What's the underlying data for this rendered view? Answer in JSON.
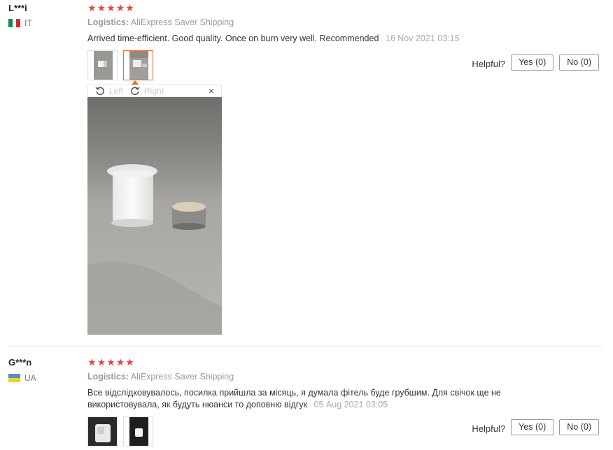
{
  "reviews": [
    {
      "user": "L***i",
      "country": "IT",
      "rating_stars": 5,
      "logistics_label": "Logistics:",
      "logistics_value": "AliExpress Saver Shipping",
      "text": "Arrived time-efficient. Good quality. Once on burn very well. Recommended",
      "date": "16 Nov 2021 03:15",
      "helpful_label": "Helpful?",
      "yes_label": "Yes (0)",
      "no_label": "No (0)",
      "viewer": {
        "left_label": "Left",
        "right_label": "Right",
        "close_symbol": "×"
      }
    },
    {
      "user": "G***n",
      "country": "UA",
      "rating_stars": 5,
      "logistics_label": "Logistics:",
      "logistics_value": "AliExpress Saver Shipping",
      "text_line1": "Все відслідковувалось, посилка прийшла за місяць, я думала фітель буде грубшим. Для свічок ще не",
      "text_line2": "використовувала, як будуть нюанси то доповню відгук",
      "date": "05 Aug 2021 03:05",
      "helpful_label": "Helpful?",
      "yes_label": "Yes (0)",
      "no_label": "No (0)"
    }
  ],
  "colors": {
    "star": "#f5413a",
    "active_thumb_border": "#e66b2e",
    "muted_text": "#999999"
  },
  "icons": [
    "star-icon",
    "flag-it-icon",
    "flag-ua-icon",
    "rotate-left-icon",
    "rotate-right-icon",
    "close-icon"
  ]
}
